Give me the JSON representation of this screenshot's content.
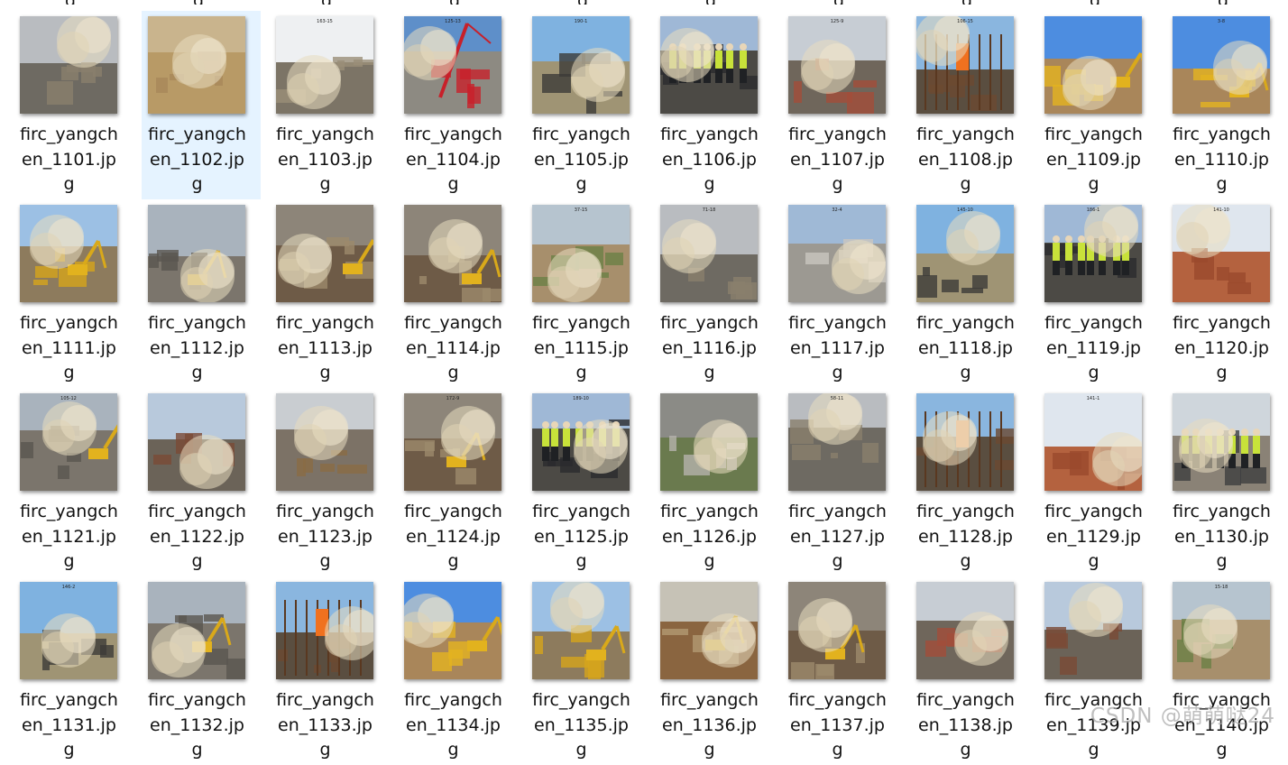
{
  "files": [
    {
      "name": "firc_yangchen_1101.jpg",
      "scene": "site",
      "tag": ""
    },
    {
      "name": "firc_yangchen_1102.jpg",
      "scene": "sand",
      "tag": "",
      "selected": true
    },
    {
      "name": "firc_yangchen_1103.jpg",
      "scene": "sky",
      "tag": "163-15"
    },
    {
      "name": "firc_yangchen_1104.jpg",
      "scene": "crane",
      "tag": "125-13"
    },
    {
      "name": "firc_yangchen_1105.jpg",
      "scene": "building",
      "tag": "190-1"
    },
    {
      "name": "firc_yangchen_1106.jpg",
      "scene": "people",
      "tag": ""
    },
    {
      "name": "firc_yangchen_1107.jpg",
      "scene": "street",
      "tag": "125-9"
    },
    {
      "name": "firc_yangchen_1108.jpg",
      "scene": "rebar",
      "tag": "106-15"
    },
    {
      "name": "firc_yangchen_1109.jpg",
      "scene": "excavator-sky",
      "tag": ""
    },
    {
      "name": "firc_yangchen_1110.jpg",
      "scene": "excavator-sky",
      "tag": "3-8"
    },
    {
      "name": "firc_yangchen_1111.jpg",
      "scene": "excavator",
      "tag": ""
    },
    {
      "name": "firc_yangchen_1112.jpg",
      "scene": "demolition",
      "tag": ""
    },
    {
      "name": "firc_yangchen_1113.jpg",
      "scene": "rubble",
      "tag": ""
    },
    {
      "name": "firc_yangchen_1114.jpg",
      "scene": "rubble",
      "tag": ""
    },
    {
      "name": "firc_yangchen_1115.jpg",
      "scene": "field",
      "tag": "37-15"
    },
    {
      "name": "firc_yangchen_1116.jpg",
      "scene": "site",
      "tag": "71-18"
    },
    {
      "name": "firc_yangchen_1117.jpg",
      "scene": "concrete",
      "tag": "32-4"
    },
    {
      "name": "firc_yangchen_1118.jpg",
      "scene": "building",
      "tag": "145-10"
    },
    {
      "name": "firc_yangchen_1119.jpg",
      "scene": "people",
      "tag": "186-1"
    },
    {
      "name": "firc_yangchen_1120.jpg",
      "scene": "red-earth",
      "tag": "141-10"
    },
    {
      "name": "firc_yangchen_1121.jpg",
      "scene": "demolition",
      "tag": "105-12"
    },
    {
      "name": "firc_yangchen_1122.jpg",
      "scene": "house",
      "tag": ""
    },
    {
      "name": "firc_yangchen_1123.jpg",
      "scene": "scaffold",
      "tag": ""
    },
    {
      "name": "firc_yangchen_1124.jpg",
      "scene": "rubble",
      "tag": "172-9"
    },
    {
      "name": "firc_yangchen_1125.jpg",
      "scene": "people",
      "tag": "189-10"
    },
    {
      "name": "firc_yangchen_1126.jpg",
      "scene": "saw",
      "tag": ""
    },
    {
      "name": "firc_yangchen_1127.jpg",
      "scene": "site",
      "tag": "58-11"
    },
    {
      "name": "firc_yangchen_1128.jpg",
      "scene": "rebar",
      "tag": ""
    },
    {
      "name": "firc_yangchen_1129.jpg",
      "scene": "red-earth",
      "tag": "141-1"
    },
    {
      "name": "firc_yangchen_1130.jpg",
      "scene": "workers",
      "tag": ""
    },
    {
      "name": "firc_yangchen_1131.jpg",
      "scene": "building",
      "tag": "146-2"
    },
    {
      "name": "firc_yangchen_1132.jpg",
      "scene": "demolition",
      "tag": ""
    },
    {
      "name": "firc_yangchen_1133.jpg",
      "scene": "rebar",
      "tag": ""
    },
    {
      "name": "firc_yangchen_1134.jpg",
      "scene": "excavator-sky",
      "tag": ""
    },
    {
      "name": "firc_yangchen_1135.jpg",
      "scene": "excavator",
      "tag": ""
    },
    {
      "name": "firc_yangchen_1136.jpg",
      "scene": "trench",
      "tag": ""
    },
    {
      "name": "firc_yangchen_1137.jpg",
      "scene": "rubble",
      "tag": ""
    },
    {
      "name": "firc_yangchen_1138.jpg",
      "scene": "street",
      "tag": ""
    },
    {
      "name": "firc_yangchen_1139.jpg",
      "scene": "house",
      "tag": ""
    },
    {
      "name": "firc_yangchen_1140.jpg",
      "scene": "field",
      "tag": "15-18"
    }
  ],
  "top_row_partial_char": "g",
  "watermark": "CSDN @萌萌哒24",
  "colors": {
    "selection_bg": "#e5f3ff",
    "text": "#111111",
    "dust": "#d9ccaa"
  }
}
